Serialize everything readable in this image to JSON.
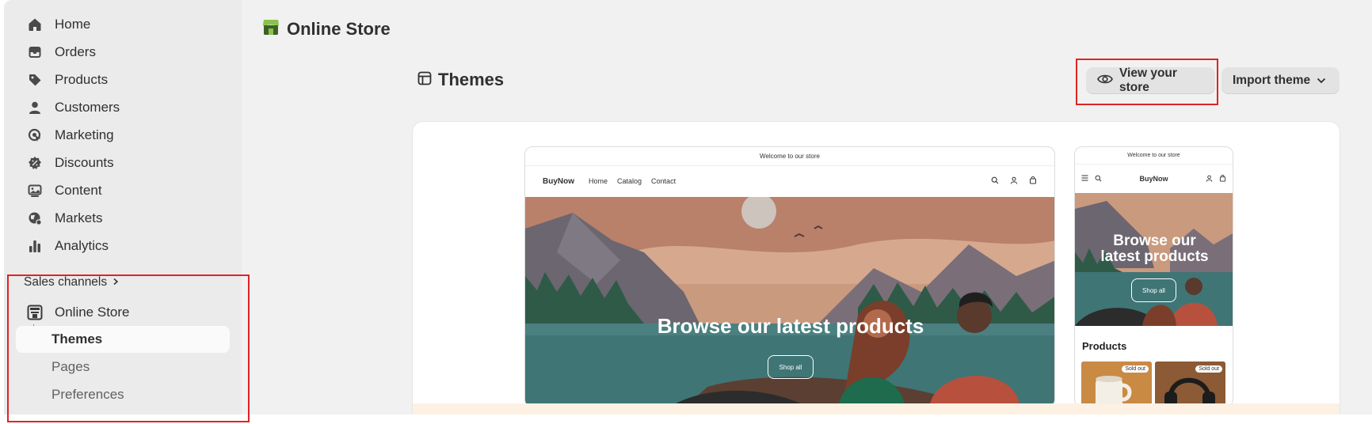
{
  "sidebar": {
    "items": [
      {
        "label": "Home",
        "icon": "home-icon"
      },
      {
        "label": "Orders",
        "icon": "inbox-icon"
      },
      {
        "label": "Products",
        "icon": "tag-icon"
      },
      {
        "label": "Customers",
        "icon": "person-icon"
      },
      {
        "label": "Marketing",
        "icon": "target-icon"
      },
      {
        "label": "Discounts",
        "icon": "discount-icon"
      },
      {
        "label": "Content",
        "icon": "image-icon"
      },
      {
        "label": "Markets",
        "icon": "globe-icon"
      },
      {
        "label": "Analytics",
        "icon": "bar-chart-icon"
      }
    ],
    "sales_channels_label": "Sales channels",
    "channel": {
      "label": "Online Store",
      "icon": "store-icon"
    },
    "sub_items": [
      {
        "label": "Themes",
        "active": true
      },
      {
        "label": "Pages",
        "active": false
      },
      {
        "label": "Preferences",
        "active": false
      }
    ]
  },
  "main": {
    "page_title": "Online Store",
    "section_title": "Themes",
    "view_store_label": "View your store",
    "import_theme_label": "Import theme"
  },
  "preview": {
    "announcement": "Welcome to our store",
    "brand": "BuyNow",
    "nav": [
      "Home",
      "Catalog",
      "Contact"
    ],
    "hero_heading": "Browse our latest products",
    "mobile_hero_heading_line1": "Browse our",
    "mobile_hero_heading_line2": "latest products",
    "shop_button": "Shop all",
    "products_heading": "Products",
    "sold_out": "Sold out"
  },
  "colors": {
    "accent_red_box": "#e02424",
    "sidebar_bg": "#ebebeb",
    "page_bg": "#f1f1f1",
    "store_icon_green": "#8bc34a"
  }
}
